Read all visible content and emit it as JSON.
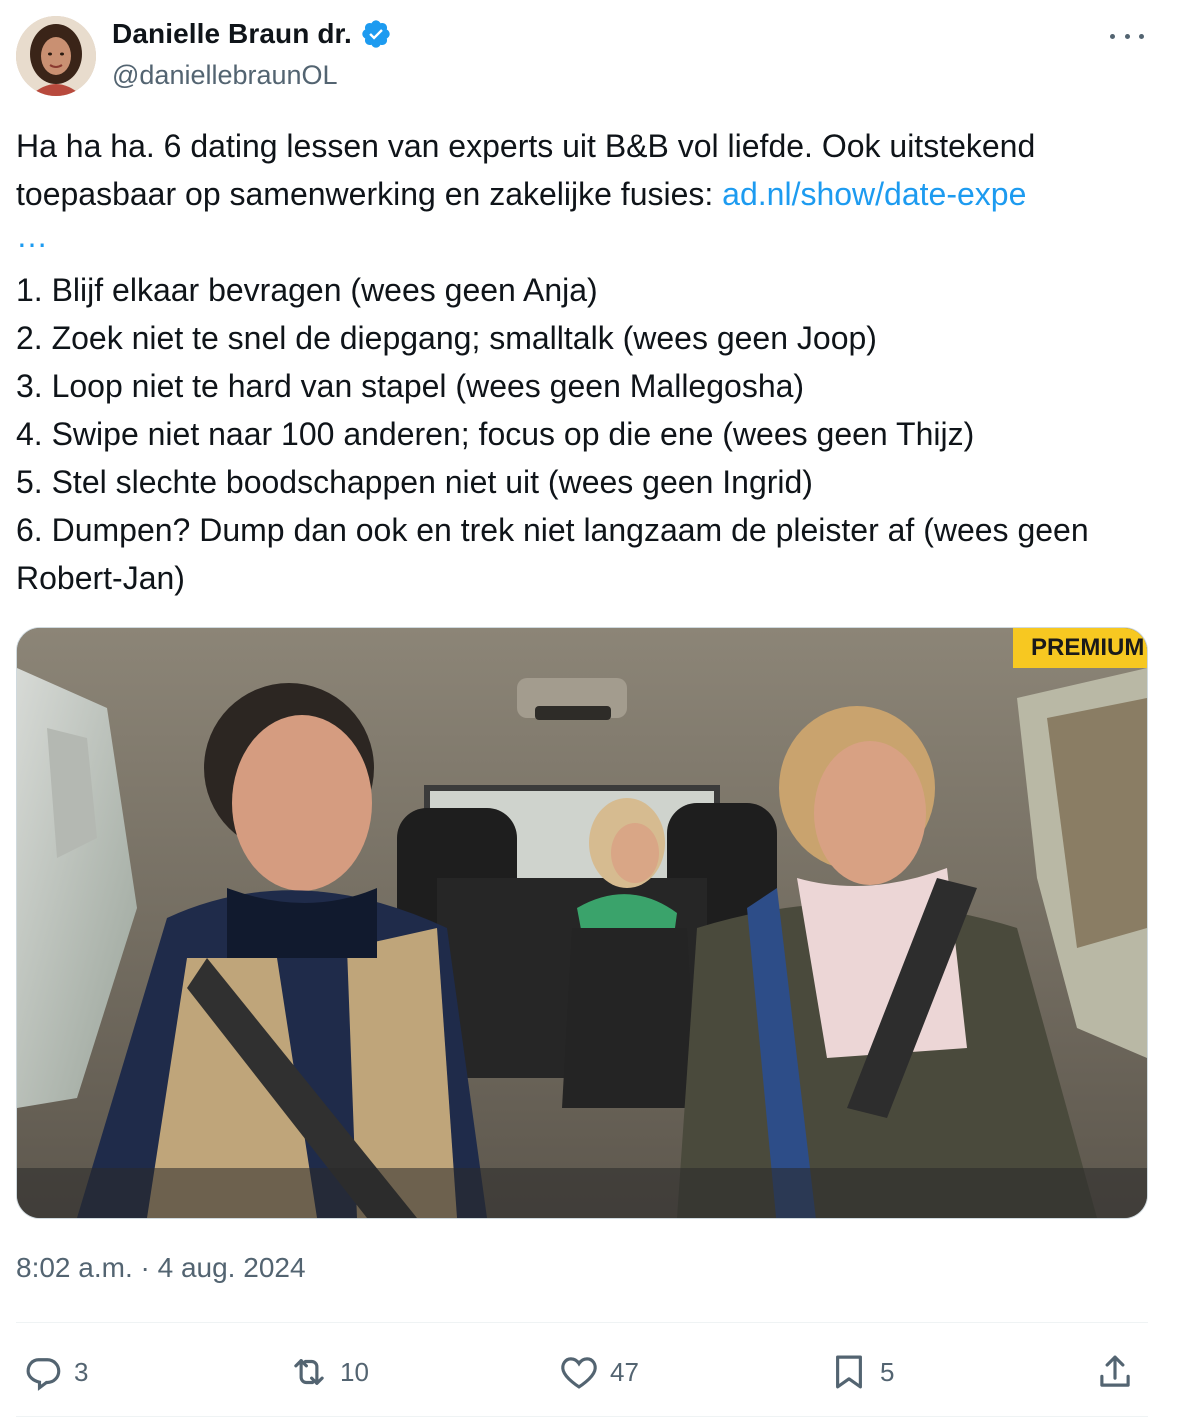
{
  "author": {
    "display_name": "Danielle Braun dr.",
    "handle": "@daniellebraunOL",
    "verified": true,
    "verified_color": "#1d9bf0"
  },
  "tweet": {
    "intro": "Ha ha ha. 6 dating lessen van experts uit B&B vol liefde. Ook uitstekend toepasbaar op samenwerking en zakelijke fusies: ",
    "link_text": "ad.nl/show/date-expe",
    "link_ellipsis": "…",
    "list": [
      "1. Blijf elkaar bevragen (wees geen Anja)",
      "2. Zoek niet te snel de diepgang; smalltalk (wees geen Joop)",
      "3. Loop niet te hard van stapel (wees geen Mallegosha)",
      "4. Swipe niet naar 100 anderen; focus op die ene (wees geen Thijz)",
      "5. Stel slechte boodschappen niet uit (wees geen Ingrid)",
      "6. Dumpen? Dump dan ook en trek niet langzaam de pleister af (wees geen Robert-Jan)"
    ]
  },
  "media": {
    "badge": "PREMIUM",
    "badge_color": "#f7c821"
  },
  "timestamp": "8:02 a.m. · 4 aug. 2024",
  "actions": {
    "replies": "3",
    "reposts": "10",
    "likes": "47",
    "bookmarks": "5"
  },
  "icons": [
    "verified-badge-icon",
    "more-icon",
    "reply-icon",
    "repost-icon",
    "like-icon",
    "bookmark-icon",
    "share-icon"
  ]
}
